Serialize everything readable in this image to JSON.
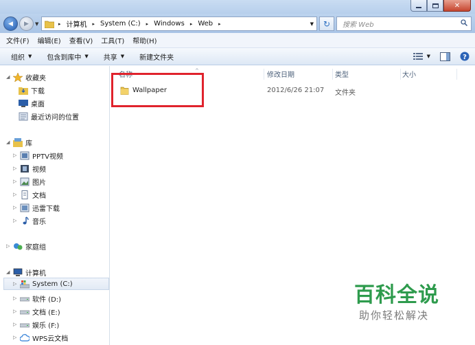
{
  "window": {
    "min_icon": "minimize-icon",
    "max_icon": "maximize-icon",
    "close_icon": "close-icon",
    "close_glyph": "✕"
  },
  "address": {
    "back_glyph": "◀",
    "forward_glyph": "▶",
    "segments": [
      "计算机",
      "System (C:)",
      "Windows",
      "Web"
    ],
    "separator": "▸",
    "refresh_glyph": "↻",
    "search_placeholder": "搜索 Web"
  },
  "menu": [
    "文件(F)",
    "编辑(E)",
    "查看(V)",
    "工具(T)",
    "帮助(H)"
  ],
  "toolbar": {
    "organize": "组织",
    "include_in_library": "包含到库中",
    "share": "共享",
    "new_folder": "新建文件夹"
  },
  "nav": {
    "favorites": "收藏夹",
    "downloads": "下载",
    "desktop": "桌面",
    "recent": "最近访问的位置",
    "libraries": "库",
    "pptv": "PPTV视频",
    "videos": "视频",
    "pictures": "图片",
    "documents": "文档",
    "xunlei": "迅雷下载",
    "music": "音乐",
    "homegroup": "家庭组",
    "computer": "计算机",
    "system_c": "System (C:)",
    "software_d": "软件 (D:)",
    "docs_e": "文档 (E:)",
    "entertainment_f": "娱乐 (F:)",
    "wps_cloud": "WPS云文档"
  },
  "columns": {
    "name": "名称",
    "modified": "修改日期",
    "type": "类型",
    "size": "大小"
  },
  "files": [
    {
      "name": "Wallpaper",
      "modified": "2012/6/26 21:07",
      "type": "文件夹",
      "size": ""
    }
  ],
  "watermark": {
    "title": "百科全说",
    "subtitle": "助你轻松解决"
  },
  "colors": {
    "highlight_box": "#e0222c",
    "watermark_green": "#2e9b4d",
    "folder_yellow": "#e8c24a"
  }
}
